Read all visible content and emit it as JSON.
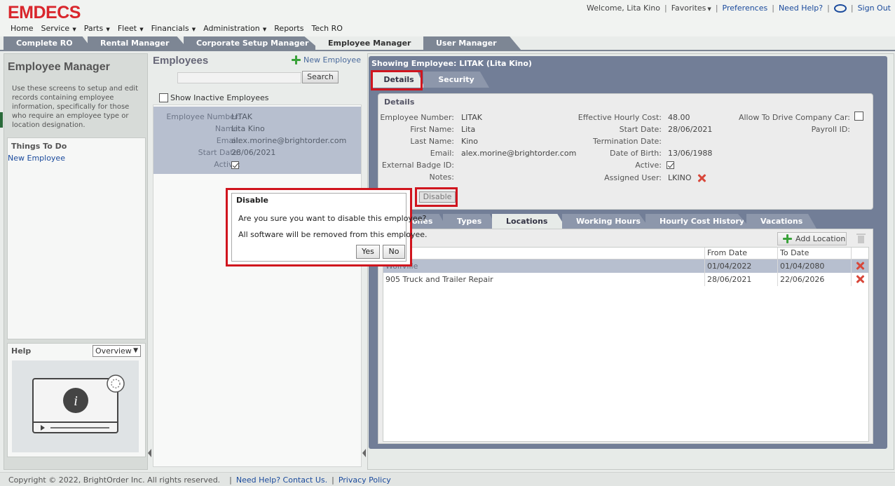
{
  "header": {
    "logo": "EMDECS",
    "welcome": "Welcome, Lita Kino",
    "favorites": "Favorites",
    "preferences": "Preferences",
    "need_help": "Need Help?",
    "sign_out": "Sign Out"
  },
  "main_nav": [
    {
      "label": "Home",
      "dropdown": false
    },
    {
      "label": "Service",
      "dropdown": true
    },
    {
      "label": "Parts",
      "dropdown": true
    },
    {
      "label": "Fleet",
      "dropdown": true
    },
    {
      "label": "Financials",
      "dropdown": true
    },
    {
      "label": "Administration",
      "dropdown": true
    },
    {
      "label": "Reports",
      "dropdown": false
    },
    {
      "label": "Tech RO",
      "dropdown": false
    }
  ],
  "module_tabs": [
    "Complete RO",
    "Rental Manager",
    "Corporate Setup Manager",
    "Employee Manager",
    "User Manager"
  ],
  "left_panel": {
    "title": "Employee Manager",
    "description": "Use these screens to setup and edit records containing employee information, specifically for those who require an employee type or location designation.",
    "todo_title": "Things To Do",
    "todo_link": "New Employee",
    "help_title": "Help",
    "help_select": "Overview"
  },
  "employees_panel": {
    "title": "Employees",
    "new_employee": "New Employee",
    "search_button": "Search",
    "search_placeholder": "",
    "show_inactive": "Show Inactive Employees",
    "selected": {
      "employee_number_label": "Employee Number:",
      "employee_number": "LITAK",
      "name_label": "Name:",
      "name": "Lita Kino",
      "email_label": "Email:",
      "email": "alex.morine@brightorder.com",
      "start_date_label": "Start Date:",
      "start_date": "28/06/2021",
      "active_label": "Active:"
    }
  },
  "details": {
    "showing": "Showing Employee: LITAK (Lita Kino)",
    "tabs": [
      "Details",
      "Security"
    ],
    "heading": "Details",
    "col1": {
      "employee_number_label": "Employee Number:",
      "employee_number": "LITAK",
      "first_name_label": "First Name:",
      "first_name": "Lita",
      "last_name_label": "Last Name:",
      "last_name": "Kino",
      "email_label": "Email:",
      "email": "alex.morine@brightorder.com",
      "badge_label": "External Badge ID:",
      "badge": "",
      "notes_label": "Notes:",
      "notes": ""
    },
    "col2": {
      "hourly_cost_label": "Effective Hourly Cost:",
      "hourly_cost": "48.00",
      "start_date_label": "Start Date:",
      "start_date": "28/06/2021",
      "termination_label": "Termination Date:",
      "termination": "",
      "dob_label": "Date of Birth:",
      "dob": "13/06/1988",
      "active_label": "Active:",
      "assigned_user_label": "Assigned User:",
      "assigned_user": "LKINO"
    },
    "col3": {
      "drive_car_label": "Allow To Drive Company Car:",
      "payroll_label": "Payroll ID:",
      "payroll": ""
    },
    "disable_button": "Disable"
  },
  "lower_tabs": [
    "Phones",
    "Types",
    "Locations",
    "Working Hours",
    "Hourly Cost History",
    "Vacations"
  ],
  "lower_tabs_visible": [
    "ones",
    "Types",
    "Locations",
    "Working Hours",
    "Hourly Cost History",
    "Vacations"
  ],
  "locations": {
    "add_button": "Add Location",
    "columns": [
      "",
      "From Date",
      "To Date"
    ],
    "rows": [
      {
        "name": "Wolfville",
        "from": "01/04/2022",
        "to": "01/04/2080"
      },
      {
        "name": "905 Truck and Trailer Repair",
        "from": "28/06/2021",
        "to": "22/06/2026"
      }
    ]
  },
  "dialog": {
    "title": "Disable",
    "message1": "Are you sure you want to disable this employee?",
    "message2": "All software will be removed from this employee.",
    "yes": "Yes",
    "no": "No"
  },
  "footer": {
    "copyright": "Copyright © 2022, BrightOrder Inc. All rights reserved.",
    "help_link": "Need Help? Contact Us.",
    "privacy": "Privacy Policy"
  },
  "colors": {
    "brand_red": "#d9262c",
    "highlight_red": "#d0151e",
    "tab_slate": "#7d8694",
    "panel_slate": "#727e97",
    "selected_row": "#b7bfcf",
    "link_blue": "#1a4a9c"
  }
}
